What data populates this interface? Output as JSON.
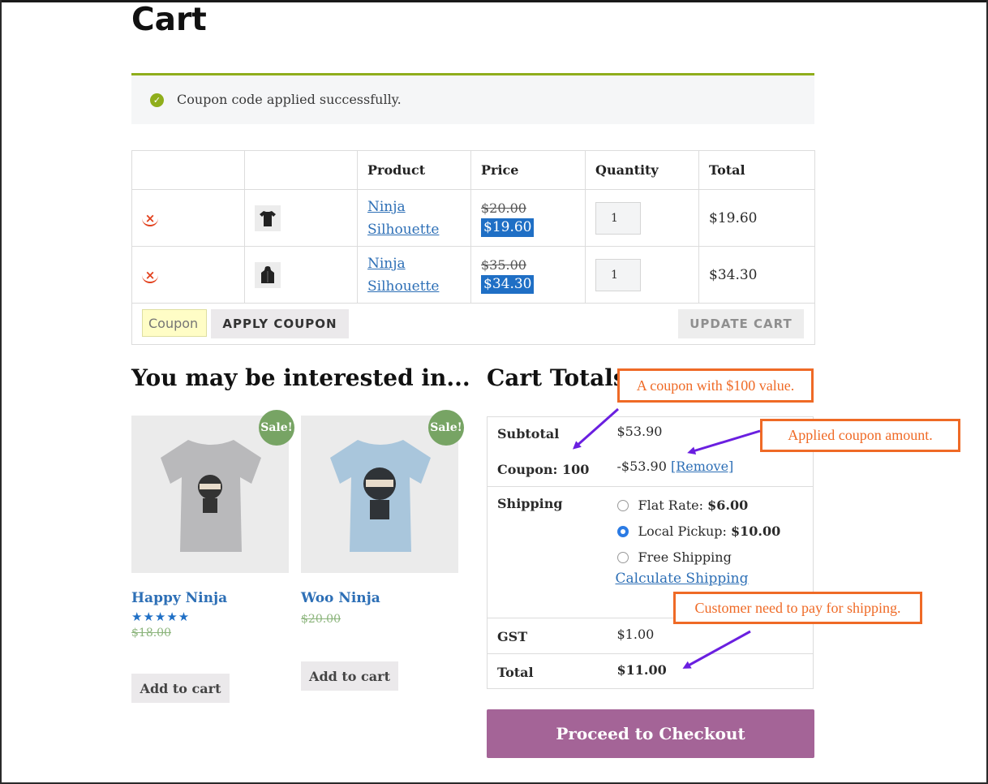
{
  "page": {
    "title": "Cart"
  },
  "notice": {
    "message": "Coupon code applied successfully."
  },
  "cart_table": {
    "headers": [
      "",
      "",
      "Product",
      "Price",
      "Quantity",
      "Total"
    ],
    "rows": [
      {
        "product_line1": "Ninja",
        "product_line2": "Silhouette",
        "old_price": "$20.00",
        "sale_price": "$19.60",
        "quantity": "1",
        "total": "$19.60",
        "thumb": "tshirt-icon"
      },
      {
        "product_line1": "Ninja",
        "product_line2": "Silhouette",
        "old_price": "$35.00",
        "sale_price": "$34.30",
        "quantity": "1",
        "total": "$34.30",
        "thumb": "hoodie-icon"
      }
    ],
    "coupon_placeholder": "Coupon",
    "apply_coupon_label": "APPLY COUPON",
    "update_cart_label": "UPDATE CART"
  },
  "related": {
    "heading": "You may be interested in...",
    "products": [
      {
        "name": "Happy Ninja",
        "price": "$18.00",
        "sale_badge": "Sale!",
        "add_label": "Add to cart",
        "rating_stars": 5,
        "shirt_color": "#b9b9bb"
      },
      {
        "name": "Woo Ninja",
        "price": "$20.00",
        "sale_badge": "Sale!",
        "add_label": "Add to cart",
        "shirt_color": "#a9c6dc"
      }
    ]
  },
  "totals": {
    "heading": "Cart Totals",
    "subtotal_label": "Subtotal",
    "subtotal_value": "$53.90",
    "coupon_label": "Coupon: 100",
    "coupon_value": "-$53.90",
    "coupon_remove": "[Remove]",
    "shipping_label": "Shipping",
    "shipping_options": [
      {
        "label": "Flat Rate: ",
        "price": "$6.00",
        "selected": false
      },
      {
        "label": "Local Pickup: ",
        "price": "$10.00",
        "selected": true
      },
      {
        "label": "Free Shipping",
        "price": "",
        "selected": false
      }
    ],
    "calculate_shipping": "Calculate Shipping",
    "gst_label": "GST",
    "gst_value": "$1.00",
    "total_label": "Total",
    "total_value": "$11.00",
    "checkout_label": "Proceed to Checkout"
  },
  "annotations": {
    "coupon_value": "A coupon with $100 value.",
    "applied_amount": "Applied coupon amount.",
    "shipping_note": "Customer need to pay for shipping.",
    "arrow_color": "#6a1fe0",
    "callout_color": "#ef6a26"
  },
  "colors": {
    "accent_link": "#2d6fb6",
    "notice_bar": "#8fae1b",
    "checkout": "#a46497",
    "sale_badge": "#77a464"
  }
}
